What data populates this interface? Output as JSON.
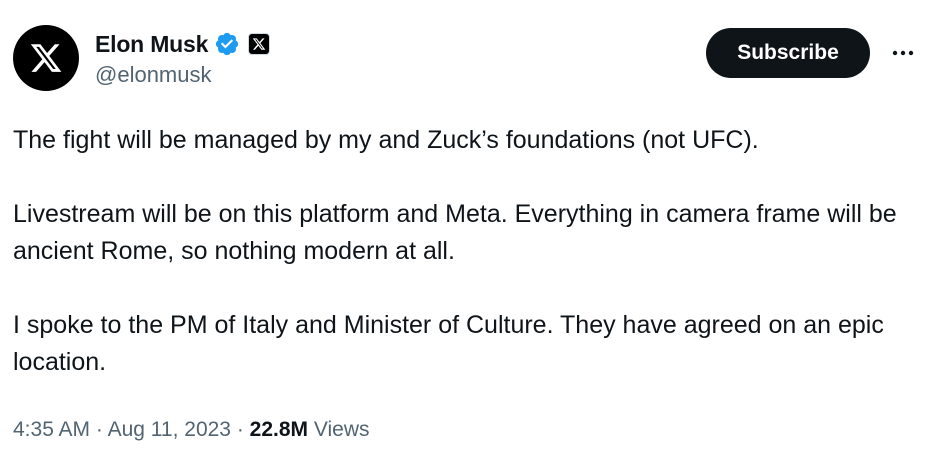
{
  "author": {
    "display_name": "Elon Musk",
    "handle": "@elonmusk",
    "avatar_icon": "x-logo-icon",
    "verified_badge_icon": "verified-badge-icon",
    "affiliation_badge_icon": "x-affiliation-badge-icon"
  },
  "actions": {
    "subscribe_label": "Subscribe",
    "more_icon": "more-options-icon"
  },
  "tweet": {
    "paragraphs": [
      "The fight will be managed by my and Zuck’s foundations (not UFC).",
      "Livestream will be on this platform and Meta. Everything in camera frame will be ancient Rome, so nothing modern at all.",
      "I spoke to the PM of Italy and Minister of Culture. They have agreed on an epic location."
    ]
  },
  "meta": {
    "time": "4:35 AM",
    "separator": "·",
    "date": "Aug 11, 2023",
    "views_count": "22.8M",
    "views_label": "Views"
  },
  "colors": {
    "verified_blue": "#1d9bf0",
    "text_primary": "#0f1419",
    "text_secondary": "#536471",
    "subscribe_bg": "#0f1419"
  }
}
